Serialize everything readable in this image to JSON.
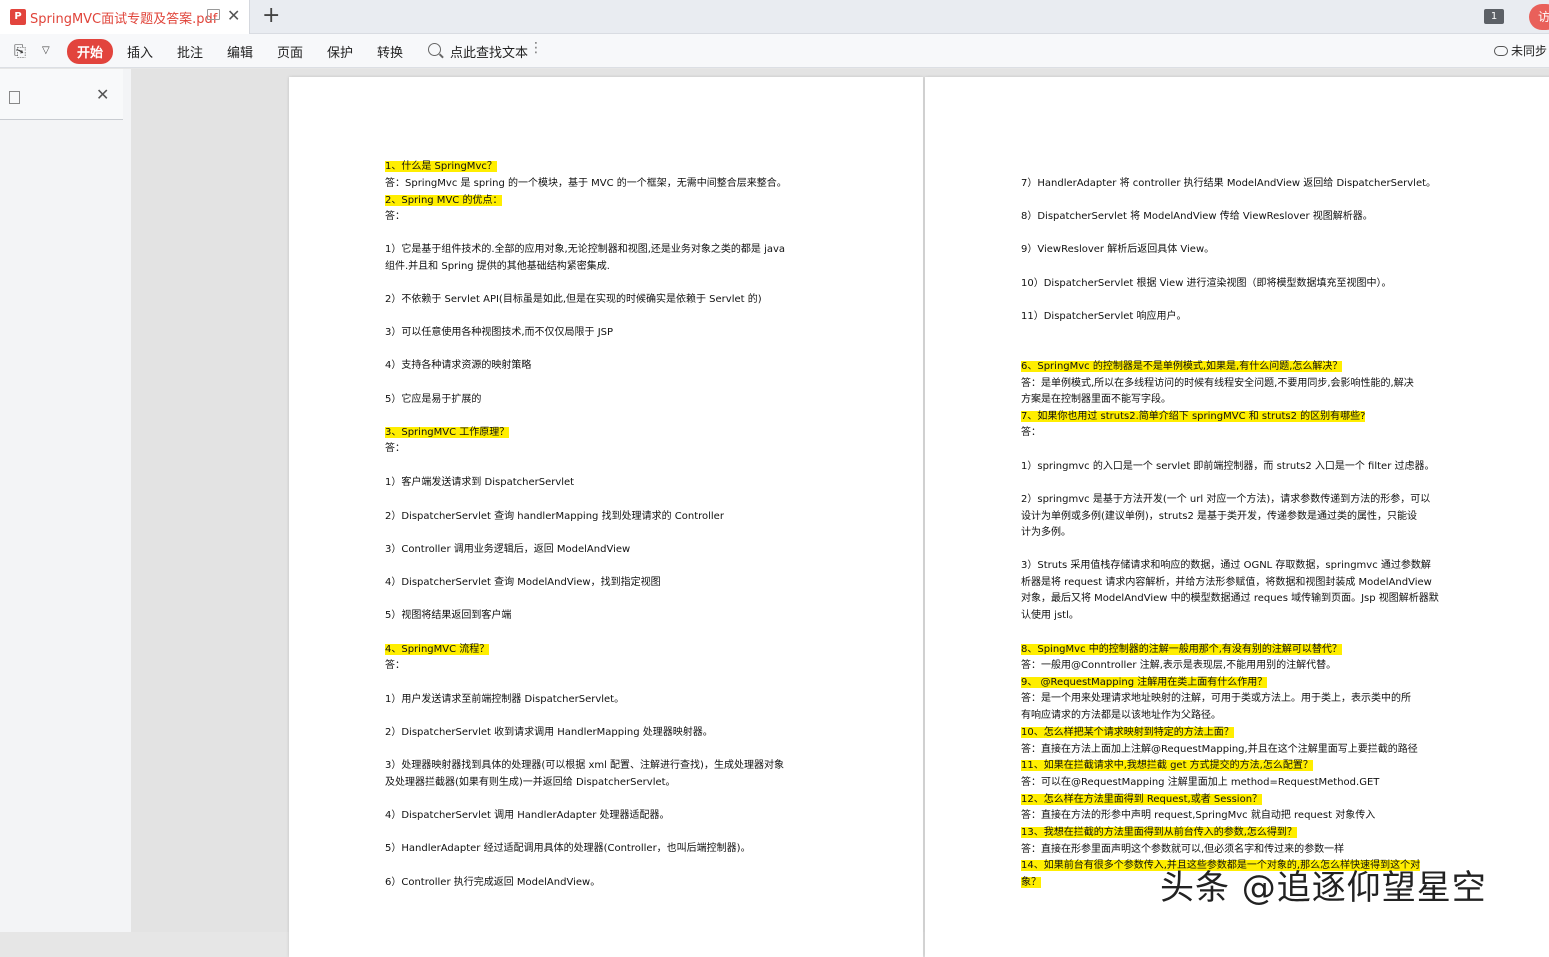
{
  "tab": {
    "title": "SpringMVC面试专题及答案.pdf",
    "icon": "pdf-icon"
  },
  "window": {
    "page_badge": "1",
    "avatar_text": "访"
  },
  "toolbar": {
    "menu": [
      "开始",
      "插入",
      "批注",
      "编辑",
      "页面",
      "保护",
      "转换"
    ],
    "active_menu": "开始",
    "search_label": "点此查找文本",
    "sync_label": "未同步"
  },
  "page_left": {
    "lines": [
      {
        "text": "1、什么是 SpringMvc？",
        "hl": true
      },
      {
        "text": "答：SpringMvc 是 spring 的一个模块，基于 MVC 的一个框架，无需中间整合层来整合。",
        "hl": false
      },
      {
        "text": "2、Spring MVC 的优点：",
        "hl": true
      },
      {
        "text": "答：",
        "hl": false
      },
      {
        "text": "1）它是基于组件技术的.全部的应用对象,无论控制器和视图,还是业务对象之类的都是 java",
        "hl": false
      },
      {
        "text": "组件.并且和 Spring 提供的其他基础结构紧密集成.",
        "hl": false
      },
      {
        "text": "2）不依赖于 Servlet API(目标虽是如此,但是在实现的时候确实是依赖于 Servlet 的)",
        "hl": false
      },
      {
        "text": "3）可以任意使用各种视图技术,而不仅仅局限于 JSP",
        "hl": false
      },
      {
        "text": "4）支持各种请求资源的映射策略",
        "hl": false
      },
      {
        "text": "5）它应是易于扩展的",
        "hl": false
      },
      {
        "text": "3、SpringMVC 工作原理？",
        "hl": true
      },
      {
        "text": "答：",
        "hl": false
      },
      {
        "text": "1）客户端发送请求到 DispatcherServlet",
        "hl": false
      },
      {
        "text": "2）DispatcherServlet 查询 handlerMapping 找到处理请求的 Controller",
        "hl": false
      },
      {
        "text": "3）Controller 调用业务逻辑后，返回 ModelAndView",
        "hl": false
      },
      {
        "text": "4）DispatcherServlet 查询 ModelAndView，找到指定视图",
        "hl": false
      },
      {
        "text": "5）视图将结果返回到客户端",
        "hl": false
      },
      {
        "text": "4、SpringMVC 流程？",
        "hl": true
      },
      {
        "text": "答：",
        "hl": false
      },
      {
        "text": "1）用户发送请求至前端控制器 DispatcherServlet。",
        "hl": false
      },
      {
        "text": "2）DispatcherServlet 收到请求调用 HandlerMapping 处理器映射器。",
        "hl": false
      },
      {
        "text": "3）处理器映射器找到具体的处理器(可以根据 xml 配置、注解进行查找)，生成处理器对象",
        "hl": false
      },
      {
        "text": "及处理器拦截器(如果有则生成)一并返回给 DispatcherServlet。",
        "hl": false
      },
      {
        "text": "4）DispatcherServlet 调用 HandlerAdapter 处理器适配器。",
        "hl": false
      },
      {
        "text": "5）HandlerAdapter 经过适配调用具体的处理器(Controller，也叫后端控制器)。",
        "hl": false
      },
      {
        "text": "6）Controller 执行完成返回 ModelAndView。",
        "hl": false
      }
    ]
  },
  "page_right": {
    "lines": [
      {
        "text": "7）HandlerAdapter 将 controller 执行结果 ModelAndView 返回给 DispatcherServlet。",
        "hl": false
      },
      {
        "text": "8）DispatcherServlet 将 ModelAndView 传给 ViewReslover 视图解析器。",
        "hl": false
      },
      {
        "text": "9）ViewReslover 解析后返回具体 View。",
        "hl": false
      },
      {
        "text": "10）DispatcherServlet 根据 View 进行渲染视图（即将模型数据填充至视图中）。",
        "hl": false
      },
      {
        "text": "11）DispatcherServlet 响应用户。",
        "hl": false
      },
      {
        "text": "6、SpringMvc 的控制器是不是单例模式,如果是,有什么问题,怎么解决？",
        "hl": true
      },
      {
        "text": "答：是单例模式,所以在多线程访问的时候有线程安全问题,不要用同步,会影响性能的,解决",
        "hl": false
      },
      {
        "text": "方案是在控制器里面不能写字段。",
        "hl": false
      },
      {
        "text": "7、如果你也用过 struts2.简单介绍下 springMVC 和 struts2 的区别有哪些?",
        "hl": true
      },
      {
        "text": "答：",
        "hl": false
      },
      {
        "text": "1）springmvc 的入口是一个 servlet 即前端控制器，而 struts2 入口是一个 filter 过虑器。",
        "hl": false
      },
      {
        "text": "2）springmvc 是基于方法开发(一个 url 对应一个方法)，请求参数传递到方法的形参，可以",
        "hl": false
      },
      {
        "text": "设计为单例或多例(建议单例)，struts2 是基于类开发，传递参数是通过类的属性，只能设",
        "hl": false
      },
      {
        "text": "计为多例。",
        "hl": false
      },
      {
        "text": "3）Struts 采用值栈存储请求和响应的数据，通过 OGNL 存取数据，springmvc 通过参数解",
        "hl": false
      },
      {
        "text": "析器是将 request 请求内容解析，并给方法形参赋值，将数据和视图封装成 ModelAndView",
        "hl": false
      },
      {
        "text": "对象，最后又将 ModelAndView 中的模型数据通过 reques 域传输到页面。Jsp 视图解析器默",
        "hl": false
      },
      {
        "text": "认使用 jstl。",
        "hl": false
      },
      {
        "text": "8、SpingMvc 中的控制器的注解一般用那个,有没有别的注解可以替代？",
        "hl": true
      },
      {
        "text": "答：一般用@Conntroller 注解,表示是表现层,不能用用别的注解代替。",
        "hl": false
      },
      {
        "text": "9、  @RequestMapping 注解用在类上面有什么作用？",
        "hl": true
      },
      {
        "text": "答：是一个用来处理请求地址映射的注解，可用于类或方法上。用于类上，表示类中的所",
        "hl": false
      },
      {
        "text": "有响应请求的方法都是以该地址作为父路径。",
        "hl": false
      },
      {
        "text": "10、怎么样把某个请求映射到特定的方法上面？",
        "hl": true
      },
      {
        "text": "答：直接在方法上面加上注解@RequestMapping,并且在这个注解里面写上要拦截的路径",
        "hl": false
      },
      {
        "text": "11、如果在拦截请求中,我想拦截 get 方式提交的方法,怎么配置？",
        "hl": true
      },
      {
        "text": "答：可以在@RequestMapping 注解里面加上 method=RequestMethod.GET",
        "hl": false
      },
      {
        "text": "12、怎么样在方法里面得到 Request,或者 Session？",
        "hl": true
      },
      {
        "text": "答：直接在方法的形参中声明 request,SpringMvc 就自动把 request 对象传入",
        "hl": false
      },
      {
        "text": "13、我想在拦截的方法里面得到从前台传入的参数,怎么得到？",
        "hl": true
      },
      {
        "text": "答：直接在形参里面声明这个参数就可以,但必须名字和传过来的参数一样",
        "hl": false
      },
      {
        "text": "14、如果前台有很多个参数传入,并且这些参数都是一个对象的,那么怎么样快速得到这个对",
        "hl": true
      },
      {
        "text": "象？",
        "hl": true
      }
    ]
  },
  "watermark": "头条 @追逐仰望星空"
}
